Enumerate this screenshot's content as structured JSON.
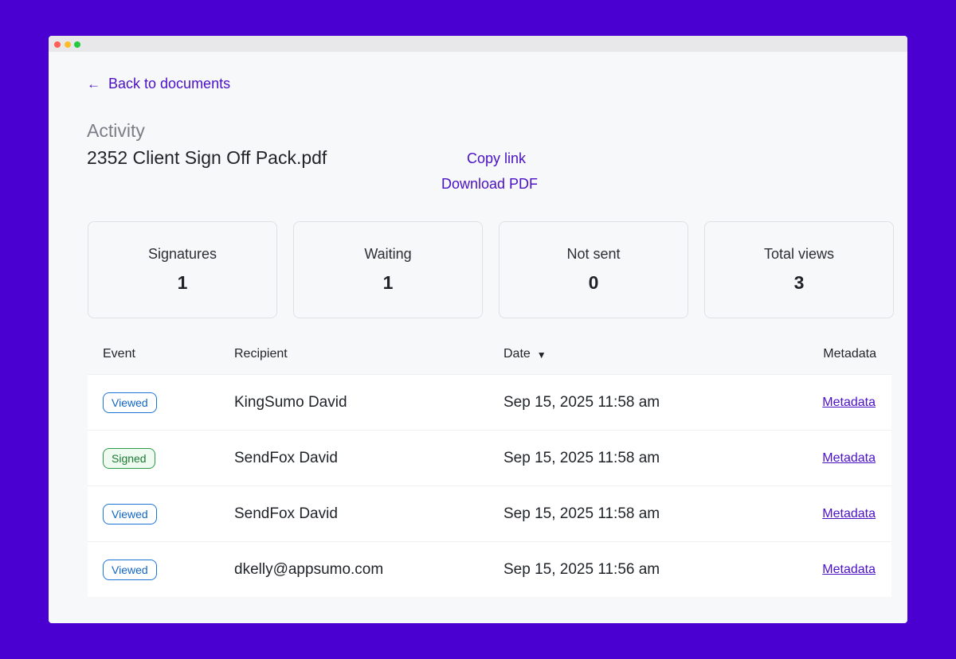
{
  "nav": {
    "back_arrow": "←",
    "back_label": "Back to documents"
  },
  "header": {
    "section_label": "Activity",
    "document_title": "2352 Client Sign Off Pack.pdf",
    "copy_link": "Copy link",
    "download_pdf": "Download PDF"
  },
  "stats": [
    {
      "label": "Signatures",
      "value": "1"
    },
    {
      "label": "Waiting",
      "value": "1"
    },
    {
      "label": "Not sent",
      "value": "0"
    },
    {
      "label": "Total views",
      "value": "3"
    }
  ],
  "table": {
    "columns": {
      "event": "Event",
      "recipient": "Recipient",
      "date": "Date",
      "metadata": "Metadata"
    },
    "sort_icon": "caret-down-icon",
    "rows": [
      {
        "event": "Viewed",
        "recipient": "KingSumo David",
        "date": "Sep 15, 2025 11:58 am",
        "metadata": "Metadata"
      },
      {
        "event": "Signed",
        "recipient": "SendFox David",
        "date": "Sep 15, 2025 11:58 am",
        "metadata": "Metadata"
      },
      {
        "event": "Viewed",
        "recipient": "SendFox David",
        "date": "Sep 15, 2025 11:58 am",
        "metadata": "Metadata"
      },
      {
        "event": "Viewed",
        "recipient": "dkelly@appsumo.com",
        "date": "Sep 15, 2025 11:56 am",
        "metadata": "Metadata"
      }
    ]
  },
  "colors": {
    "background": "#4a00d0",
    "accent": "#4a10c4",
    "viewed": "#1b75d9",
    "signed": "#2a9a45"
  }
}
